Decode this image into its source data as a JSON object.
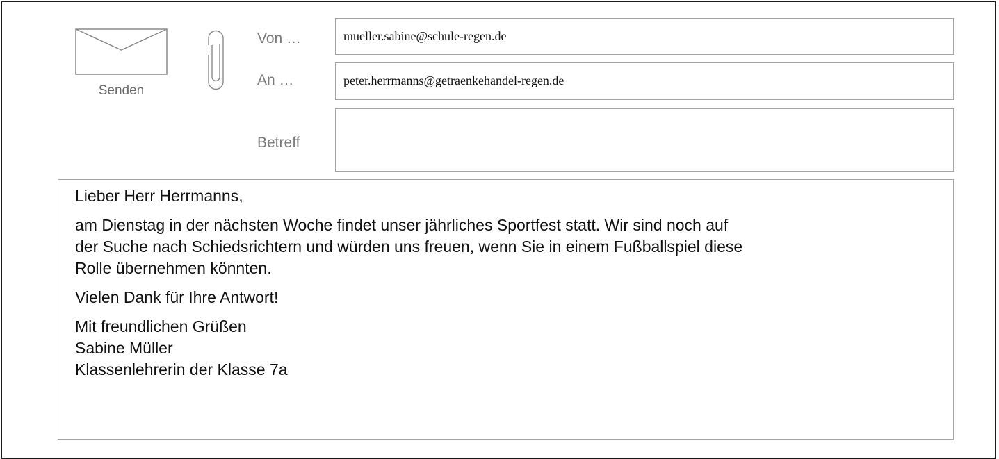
{
  "toolbar": {
    "send_label": "Senden",
    "send_icon": "envelope-icon",
    "attach_icon": "paperclip-icon"
  },
  "fields": {
    "from_label": "Von …",
    "from_value": "mueller.sabine@schule-regen.de",
    "to_label": "An …",
    "to_value": "peter.herrmanns@getraenkehandel-regen.de",
    "subject_label": "Betreff",
    "subject_value": ""
  },
  "message": {
    "greeting": "Lieber Herr Herrmanns,",
    "paragraph_lines": [
      "am Dienstag in der nächsten Woche findet unser jährliches Sportfest statt. Wir sind noch auf",
      "der Suche nach Schiedsrichtern und würden uns freuen, wenn Sie in einem Fußballspiel diese",
      "Rolle übernehmen könnten."
    ],
    "thanks": "Vielen Dank für Ihre Antwort!",
    "closing": "Mit freundlichen Grüßen",
    "sender_name": "Sabine Müller",
    "sender_role": "Klassenlehrerin der Klasse 7a"
  },
  "colors": {
    "border": "#a6a6a6",
    "label": "#7a7a7a",
    "frame": "#1a1a1a"
  }
}
